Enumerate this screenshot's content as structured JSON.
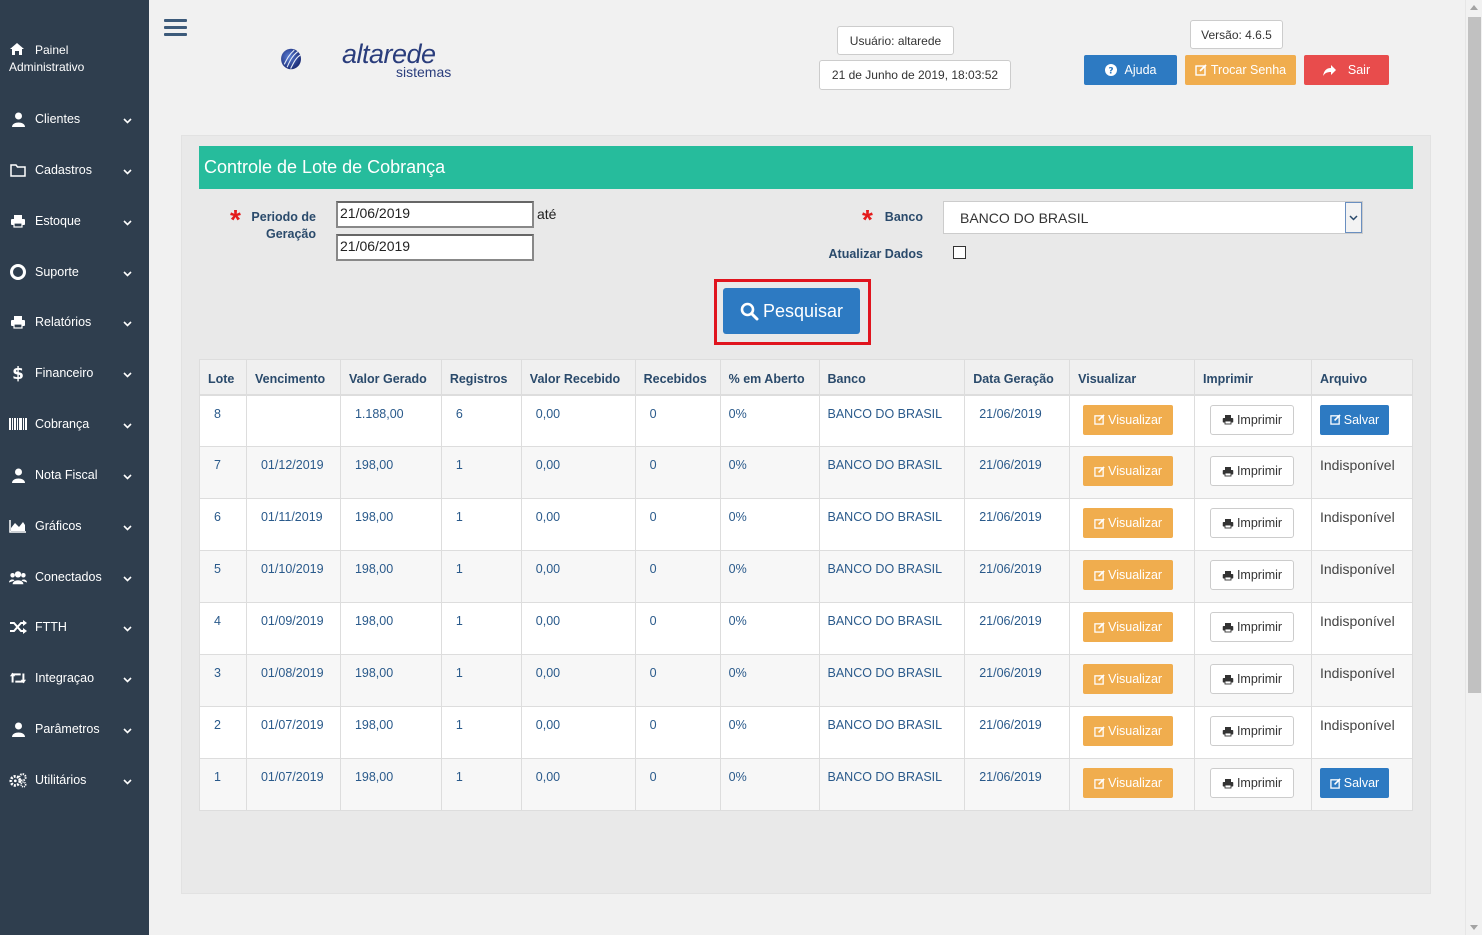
{
  "sidebar": {
    "header": {
      "line1": "Painel",
      "line2": "Administrativo",
      "icon": "home-icon"
    },
    "items": [
      {
        "label": "Clientes",
        "icon": "user-icon"
      },
      {
        "label": "Cadastros",
        "icon": "folder-icon"
      },
      {
        "label": "Estoque",
        "icon": "print-icon"
      },
      {
        "label": "Suporte",
        "icon": "lifebuoy-icon"
      },
      {
        "label": "Relatórios",
        "icon": "print-icon"
      },
      {
        "label": "Financeiro",
        "icon": "dollar-icon"
      },
      {
        "label": "Cobrança",
        "icon": "barcode-icon"
      },
      {
        "label": "Nota Fiscal",
        "icon": "user-icon"
      },
      {
        "label": "Gráficos",
        "icon": "area-chart-icon"
      },
      {
        "label": "Conectados",
        "icon": "users-icon"
      },
      {
        "label": "FTTH",
        "icon": "random-icon"
      },
      {
        "label": "Integraçao",
        "icon": "retweet-icon"
      },
      {
        "label": "Parâmetros",
        "icon": "user-icon"
      },
      {
        "label": "Utilitários",
        "icon": "cogs-icon"
      }
    ]
  },
  "header": {
    "logo_main": "altarede",
    "logo_sub": "sistemas",
    "user": "Usuário: altarede",
    "datetime": "21 de Junho de 2019, 18:03:52",
    "version": "Versão: 4.6.5",
    "help_label": "Ajuda",
    "change_password_label": "Trocar Senha",
    "logout_label": "Sair"
  },
  "panel": {
    "title": "Controle de Lote de Cobrança",
    "period_label_1": "Periodo de",
    "period_label_2": "Geração",
    "date_from": "21/06/2019",
    "date_to": "21/06/2019",
    "ate": "até",
    "bank_label": "Banco",
    "bank_value": "BANCO DO BRASIL",
    "update_label": "Atualizar Dados",
    "search_label": "Pesquisar"
  },
  "table": {
    "columns": [
      "Lote",
      "Vencimento",
      "Valor Gerado",
      "Registros",
      "Valor Recebido",
      "Recebidos",
      "% em Aberto",
      "Banco",
      "Data Geração",
      "Visualizar",
      "Imprimir",
      "Arquivo"
    ],
    "view_label": "Visualizar",
    "print_label": "Imprimir",
    "save_label": "Salvar",
    "unavailable_label": "Indisponível",
    "rows": [
      {
        "lote": "8",
        "venc": "",
        "valor": "1.188,00",
        "registros": "6",
        "recebido": "0,00",
        "recebidos": "0",
        "aberto": "0%",
        "banco": "BANCO DO BRASIL",
        "data": "21/06/2019",
        "arquivo": "save"
      },
      {
        "lote": "7",
        "venc": "01/12/2019",
        "valor": "198,00",
        "registros": "1",
        "recebido": "0,00",
        "recebidos": "0",
        "aberto": "0%",
        "banco": "BANCO DO BRASIL",
        "data": "21/06/2019",
        "arquivo": "unavailable"
      },
      {
        "lote": "6",
        "venc": "01/11/2019",
        "valor": "198,00",
        "registros": "1",
        "recebido": "0,00",
        "recebidos": "0",
        "aberto": "0%",
        "banco": "BANCO DO BRASIL",
        "data": "21/06/2019",
        "arquivo": "unavailable"
      },
      {
        "lote": "5",
        "venc": "01/10/2019",
        "valor": "198,00",
        "registros": "1",
        "recebido": "0,00",
        "recebidos": "0",
        "aberto": "0%",
        "banco": "BANCO DO BRASIL",
        "data": "21/06/2019",
        "arquivo": "unavailable"
      },
      {
        "lote": "4",
        "venc": "01/09/2019",
        "valor": "198,00",
        "registros": "1",
        "recebido": "0,00",
        "recebidos": "0",
        "aberto": "0%",
        "banco": "BANCO DO BRASIL",
        "data": "21/06/2019",
        "arquivo": "unavailable"
      },
      {
        "lote": "3",
        "venc": "01/08/2019",
        "valor": "198,00",
        "registros": "1",
        "recebido": "0,00",
        "recebidos": "0",
        "aberto": "0%",
        "banco": "BANCO DO BRASIL",
        "data": "21/06/2019",
        "arquivo": "unavailable"
      },
      {
        "lote": "2",
        "venc": "01/07/2019",
        "valor": "198,00",
        "registros": "1",
        "recebido": "0,00",
        "recebidos": "0",
        "aberto": "0%",
        "banco": "BANCO DO BRASIL",
        "data": "21/06/2019",
        "arquivo": "unavailable"
      },
      {
        "lote": "1",
        "venc": "01/07/2019",
        "valor": "198,00",
        "registros": "1",
        "recebido": "0,00",
        "recebidos": "0",
        "aberto": "0%",
        "banco": "BANCO DO BRASIL",
        "data": "21/06/2019",
        "arquivo": "save"
      }
    ]
  },
  "colors": {
    "sidebar": "#2f3e4e",
    "panel_title": "#26bc9c",
    "primary": "#2d7ac2",
    "warning": "#f0ad4e",
    "danger": "#e84c4c",
    "highlight": "#e0141e"
  }
}
